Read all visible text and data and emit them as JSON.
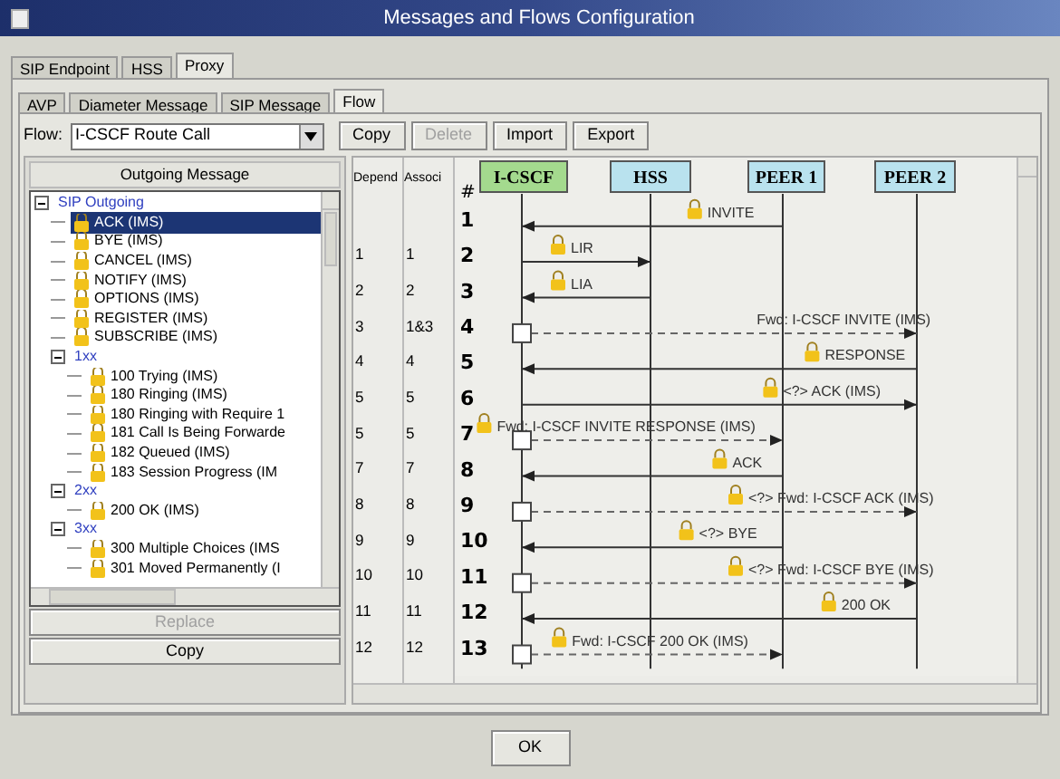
{
  "window": {
    "title": "Messages and Flows Configuration"
  },
  "tabs": [
    {
      "label": "SIP Endpoint",
      "selected": false
    },
    {
      "label": "HSS",
      "selected": false
    },
    {
      "label": "Proxy",
      "selected": true
    }
  ],
  "subtabs": [
    {
      "label": "AVP",
      "selected": false
    },
    {
      "label": "Diameter Message",
      "selected": false
    },
    {
      "label": "SIP Message",
      "selected": false
    },
    {
      "label": "Flow",
      "selected": true
    }
  ],
  "flow": {
    "label": "Flow:",
    "value": "I-CSCF Route Call"
  },
  "toolbar": [
    {
      "label": "Copy",
      "disabled": false
    },
    {
      "label": "Delete",
      "disabled": true
    },
    {
      "label": "Import",
      "disabled": false
    },
    {
      "label": "Export",
      "disabled": false
    }
  ],
  "outgoing": {
    "header": "Outgoing Message",
    "tree": [
      {
        "label": "SIP Outgoing",
        "lock": false,
        "selected": false,
        "expanded": true,
        "children": [
          {
            "label": "ACK (IMS)",
            "lock": true,
            "selected": true
          },
          {
            "label": "BYE (IMS)",
            "lock": true,
            "selected": false
          },
          {
            "label": "CANCEL (IMS)",
            "lock": true,
            "selected": false
          },
          {
            "label": "NOTIFY (IMS)",
            "lock": true,
            "selected": false
          },
          {
            "label": "OPTIONS (IMS)",
            "lock": true,
            "selected": false
          },
          {
            "label": "REGISTER (IMS)",
            "lock": true,
            "selected": false
          },
          {
            "label": "SUBSCRIBE (IMS)",
            "lock": true,
            "selected": false
          },
          {
            "label": "1xx",
            "lock": false,
            "selected": false,
            "expanded": true,
            "children": [
              {
                "label": "100 Trying (IMS)",
                "lock": true,
                "selected": false
              },
              {
                "label": "180 Ringing (IMS)",
                "lock": true,
                "selected": false
              },
              {
                "label": "180 Ringing with Require 1",
                "lock": true,
                "selected": false
              },
              {
                "label": "181 Call Is Being Forwarde",
                "lock": true,
                "selected": false
              },
              {
                "label": "182 Queued (IMS)",
                "lock": true,
                "selected": false
              },
              {
                "label": "183 Session Progress (IM",
                "lock": true,
                "selected": false
              }
            ]
          },
          {
            "label": "2xx",
            "lock": false,
            "selected": false,
            "expanded": true,
            "children": [
              {
                "label": "200 OK (IMS)",
                "lock": true,
                "selected": false
              }
            ]
          },
          {
            "label": "3xx",
            "lock": false,
            "selected": false,
            "expanded": true,
            "children": [
              {
                "label": "300 Multiple Choices (IMS",
                "lock": true,
                "selected": false
              },
              {
                "label": "301 Moved Permanently (I",
                "lock": true,
                "selected": false
              }
            ]
          }
        ]
      }
    ],
    "buttons": [
      {
        "label": "Replace",
        "disabled": true
      },
      {
        "label": "Copy",
        "disabled": false
      }
    ]
  },
  "table": {
    "columns": [
      "Depend",
      "Associ"
    ],
    "rows": [
      [
        "",
        ""
      ],
      [
        "1",
        "1"
      ],
      [
        "2",
        "2"
      ],
      [
        "3",
        "1&3"
      ],
      [
        "4",
        "4"
      ],
      [
        "5",
        "5"
      ],
      [
        "5",
        "5"
      ],
      [
        "7",
        "7"
      ],
      [
        "8",
        "8"
      ],
      [
        "9",
        "9"
      ],
      [
        "10",
        "10"
      ],
      [
        "11",
        "11"
      ],
      [
        "12",
        "12"
      ]
    ]
  },
  "diagram": {
    "number_header": "#",
    "entities": [
      {
        "name": "I-CSCF",
        "color": "#a4da8e"
      },
      {
        "name": "HSS",
        "color": "#b9e2ee"
      },
      {
        "name": "PEER 1",
        "color": "#b9e2ee"
      },
      {
        "name": "PEER 2",
        "color": "#b9e2ee"
      }
    ],
    "messages": [
      {
        "number": "1",
        "label": "INVITE",
        "lock": true,
        "dashed": false,
        "box": false
      },
      {
        "number": "2",
        "label": "LIR",
        "lock": true,
        "dashed": false,
        "box": false
      },
      {
        "number": "3",
        "label": "LIA",
        "lock": true,
        "dashed": false,
        "box": false
      },
      {
        "number": "4",
        "label": "Fwd: I-CSCF INVITE (IMS)",
        "lock": false,
        "dashed": true,
        "box": true
      },
      {
        "number": "5",
        "label": "RESPONSE",
        "lock": true,
        "dashed": false,
        "box": false
      },
      {
        "number": "6",
        "label": "<?> ACK (IMS)",
        "lock": true,
        "dashed": false,
        "box": false
      },
      {
        "number": "7",
        "label": "Fwd: I-CSCF INVITE RESPONSE (IMS)",
        "lock": true,
        "dashed": true,
        "box": true
      },
      {
        "number": "8",
        "label": "ACK",
        "lock": true,
        "dashed": false,
        "box": false
      },
      {
        "number": "9",
        "label": "<?> Fwd: I-CSCF ACK (IMS)",
        "lock": true,
        "dashed": true,
        "box": true
      },
      {
        "number": "10",
        "label": "<?> BYE",
        "lock": true,
        "dashed": false,
        "box": false
      },
      {
        "number": "11",
        "label": "<?> Fwd: I-CSCF BYE (IMS)",
        "lock": true,
        "dashed": true,
        "box": true
      },
      {
        "number": "12",
        "label": "200 OK",
        "lock": true,
        "dashed": false,
        "box": false
      },
      {
        "number": "13",
        "label": "Fwd: I-CSCF 200 OK (IMS)",
        "lock": true,
        "dashed": true,
        "box": true
      }
    ]
  },
  "ok_button": "OK"
}
